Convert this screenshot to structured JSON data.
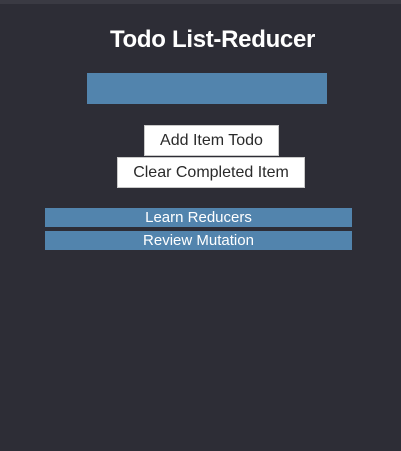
{
  "app": {
    "title": "Todo List-Reducer"
  },
  "input": {
    "value": "",
    "placeholder": ""
  },
  "buttons": {
    "add_label": "Add Item Todo",
    "clear_label": "Clear Completed Item"
  },
  "todos": [
    {
      "label": "Learn Reducers"
    },
    {
      "label": "Review Mutation"
    }
  ],
  "colors": {
    "background": "#2d2d36",
    "accent": "#5284ad",
    "button_bg": "#ffffff",
    "text_light": "#ffffff"
  }
}
